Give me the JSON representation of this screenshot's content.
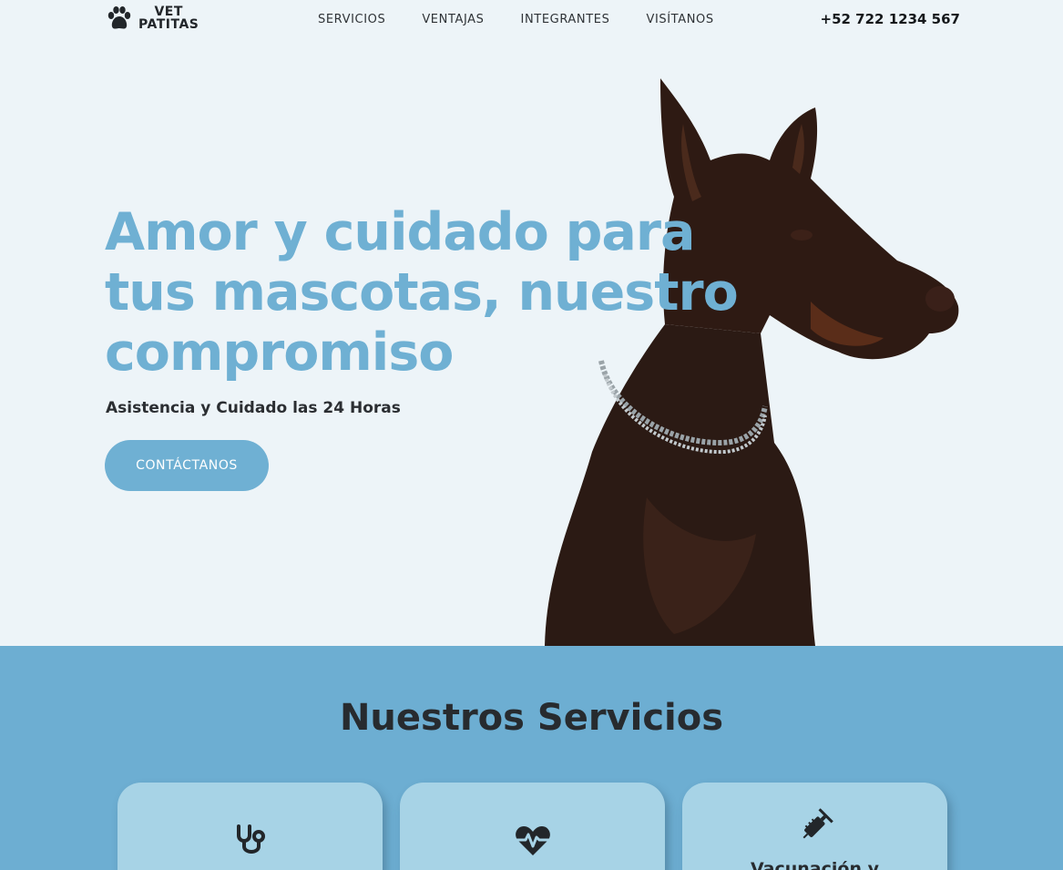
{
  "brand": {
    "line1": "VET",
    "line2": "PATITAS",
    "icon": "paw-icon"
  },
  "nav": {
    "items": [
      {
        "label": "SERVICIOS"
      },
      {
        "label": "VENTAJAS"
      },
      {
        "label": "INTEGRANTES"
      },
      {
        "label": "VISÍTANOS"
      }
    ],
    "phone": "+52 722 1234 567"
  },
  "hero": {
    "title": "Amor y cuidado para tus mascotas, nuestro compromiso",
    "subtitle": "Asistencia y Cuidado las 24 Horas",
    "cta_label": "CONTÁCTANOS",
    "image": "doberman-photo"
  },
  "services": {
    "heading": "Nuestros Servicios",
    "cards": [
      {
        "icon": "stethoscope-icon",
        "title": ""
      },
      {
        "icon": "heartbeat-icon",
        "title": ""
      },
      {
        "icon": "syringe-icon",
        "title": "Vacunación y"
      }
    ]
  },
  "colors": {
    "accent": "#6fb0d3",
    "hero_bg": "#edf4f8",
    "services_bg": "#6daed2",
    "card_bg": "#a7d3e6",
    "dark_text": "#2a2d31"
  }
}
